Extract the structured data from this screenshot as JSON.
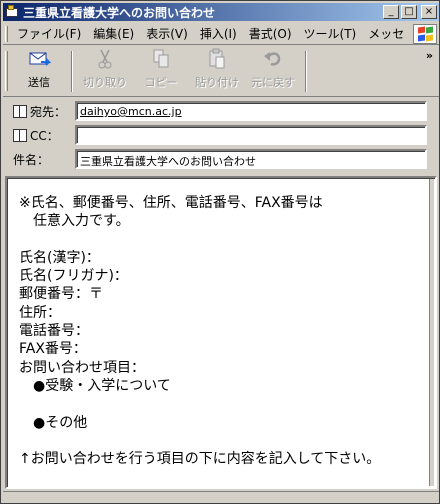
{
  "window": {
    "title": "三重県立看護大学へのお問い合わせ",
    "controls": {
      "minimize": "_",
      "maximize": "□",
      "close": "×"
    }
  },
  "menu": {
    "items": [
      "ファイル(F)",
      "編集(E)",
      "表示(V)",
      "挿入(I)",
      "書式(O)",
      "ツール(T)",
      "メッセ"
    ],
    "more": "»"
  },
  "toolbar": {
    "send": "送信",
    "cut": "切り取り",
    "copy": "コピー",
    "paste": "貼り付け",
    "undo": "元に戻す",
    "more": "»"
  },
  "header": {
    "to_label": "宛先：",
    "to_value": "daihyo@mcn.ac.jp",
    "cc_label": "CC：",
    "cc_value": "",
    "subject_label": "件名：",
    "subject_value": "三重県立看護大学へのお問い合わせ"
  },
  "body": {
    "text": "※氏名、郵便番号、住所、電話番号、FAX番号は\n　任意入力です。\n\n氏名(漢字)：\n氏名(フリガナ)：\n郵便番号：〒\n住所：\n電話番号：\nFAX番号：\nお問い合わせ項目：\n　●受験・入学について\n\n　●その他\n\n↑お問い合わせを行う項目の下に内容を記入して下さい。"
  },
  "colors": {
    "titlebar_start": "#0a246a",
    "titlebar_end": "#a6caf0",
    "window_face": "#d4d0c8"
  },
  "icons": {
    "app": "mail-envelope-icon",
    "send": "send-envelope-icon",
    "cut": "scissors-icon",
    "copy": "copy-icon",
    "paste": "clipboard-icon",
    "undo": "undo-arrow-icon",
    "address_book": "address-book-icon",
    "windows_logo": "windows-logo-icon"
  }
}
